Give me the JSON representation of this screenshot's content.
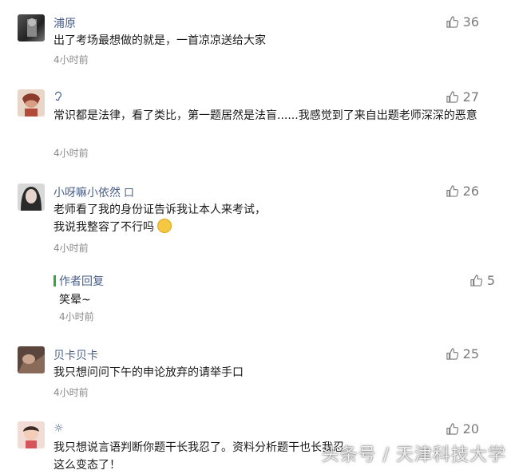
{
  "comments": [
    {
      "name": "浦原",
      "badge": "",
      "likes": "36",
      "text": "出了考场最想做的就是，一首凉凉送给大家",
      "time": "4小时前",
      "avatar_color": "#3a3a3a"
    },
    {
      "name": "",
      "badge": "ear-icon",
      "likes": "27",
      "text": "常识都是法律，看了类比，第一题居然是法盲......我感觉到了来自出题老师深深的恶意",
      "time": "4小时前",
      "avatar_color": "#c98a70"
    },
    {
      "name": "小呀嘛小依然",
      "badge": "口",
      "likes": "26",
      "text_line1": "老师看了我的身份证告诉我让本人来考试，",
      "text_line2": "我说我整容了不行吗",
      "time": "4小时前",
      "avatar_color": "#9a9a9a",
      "reply": {
        "name": "作者回复",
        "likes": "5",
        "text": "笑晕~",
        "time": "4小时前"
      }
    },
    {
      "name": "贝卡贝卡",
      "badge": "",
      "likes": "25",
      "text": "我只想问问下午的申论放弃的请举手口",
      "time": "4小时前",
      "avatar_color": "#6b5548"
    },
    {
      "name": "☼",
      "badge": "",
      "likes": "20",
      "text_line1": "我只想说言语判断你题干长我忍了。资料分析题干也长我忍",
      "text_line2": "这么变态了！",
      "avatar_color": "#e8c6c0"
    }
  ],
  "watermark": "头条号 / 天津科技大学",
  "colors": {
    "name": "#4a5f8a",
    "reply_bar": "#35a843",
    "meta": "#8a8a8a"
  }
}
